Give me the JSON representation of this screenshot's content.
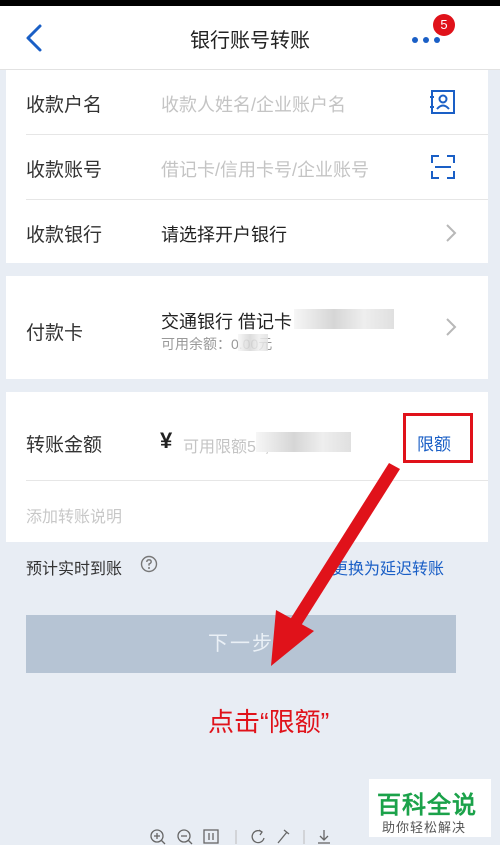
{
  "nav": {
    "title": "银行账号转账",
    "badge_count": "5"
  },
  "payee": {
    "name_label": "收款户名",
    "name_placeholder": "收款人姓名/企业账户名",
    "account_label": "收款账号",
    "account_placeholder": "借记卡/信用卡号/企业账号",
    "bank_label": "收款银行",
    "bank_value": "请选择开户银行"
  },
  "payment_card": {
    "label": "付款卡",
    "card_name": "交通银行 借记卡",
    "balance_label": "可用余额：0.00元"
  },
  "amount": {
    "label": "转账金额",
    "currency": "¥",
    "limit_hint": "可用限额50,000.00",
    "limit_link": "限额"
  },
  "note_placeholder": "添加转账说明",
  "arrival": {
    "text": "预计实时到账",
    "help_icon": "help-circle-icon",
    "switch_link": "更换为延迟转账"
  },
  "next_button": "下一步",
  "annotation": "点击“限额”",
  "watermark": {
    "title": "百科全说",
    "subtitle": "助你轻松解决"
  },
  "colors": {
    "accent_blue": "#1a5fc6",
    "annotation_red": "#e0121a",
    "disabled_button": "#b6c4d4",
    "watermark_green": "#1ba24a"
  }
}
